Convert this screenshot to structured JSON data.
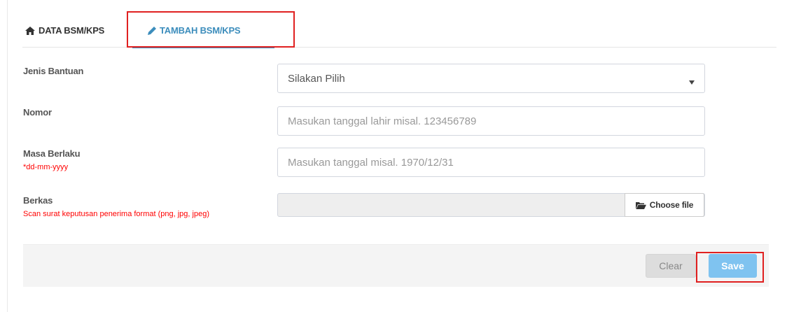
{
  "tabs": [
    {
      "label": "DATA BSM/KPS",
      "icon": "home-icon",
      "active": false
    },
    {
      "label": "TAMBAH BSM/KPS",
      "icon": "pencil-icon",
      "active": true
    }
  ],
  "form": {
    "jenis_bantuan": {
      "label": "Jenis Bantuan",
      "value": "Silakan Pilih"
    },
    "nomor": {
      "label": "Nomor",
      "placeholder": "Masukan tanggal lahir misal. 123456789"
    },
    "masa_berlaku": {
      "label": "Masa Berlaku",
      "hint": "*dd-mm-yyyy",
      "placeholder": "Masukan tanggal misal. 1970/12/31"
    },
    "berkas": {
      "label": "Berkas",
      "hint": "Scan surat keputusan penerima format (png, jpg, jpeg)",
      "button_label": "Choose file",
      "button_icon": "folder-open-icon"
    }
  },
  "footer": {
    "clear_label": "Clear",
    "save_label": "Save"
  },
  "colors": {
    "accent": "#3c8dbc",
    "hint": "#ff0000",
    "highlight": "#e02020",
    "save_button": "#7fc3f0"
  }
}
